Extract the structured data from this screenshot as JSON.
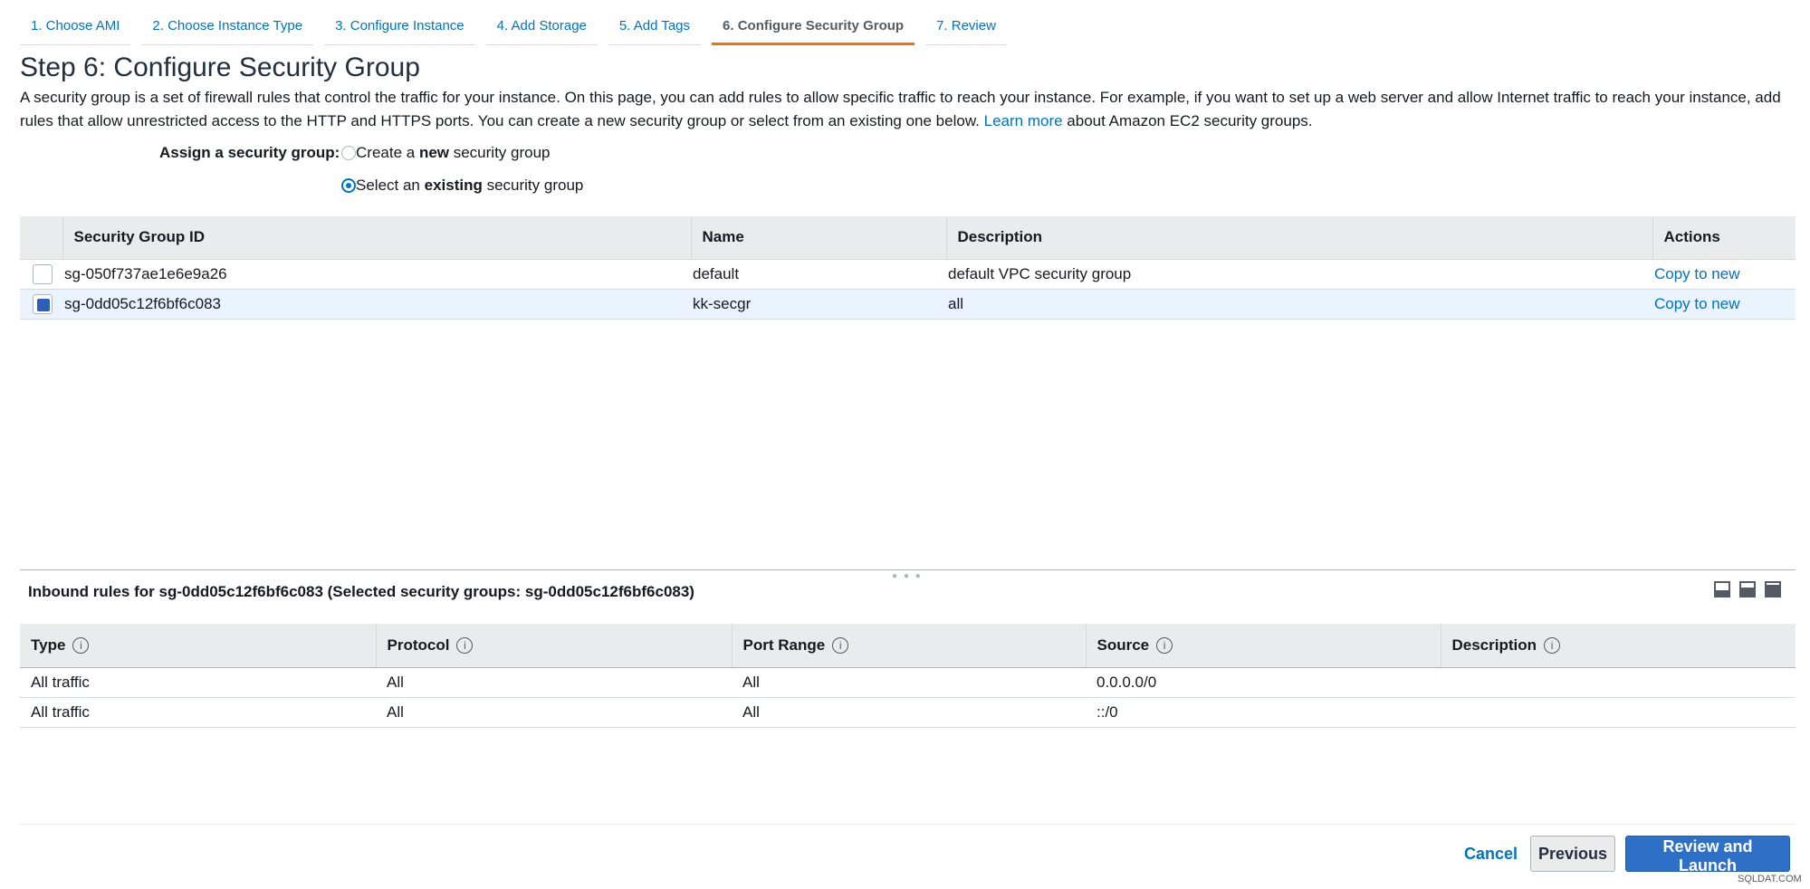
{
  "wizard_tabs": [
    "1. Choose AMI",
    "2. Choose Instance Type",
    "3. Configure Instance",
    "4. Add Storage",
    "5. Add Tags",
    "6. Configure Security Group",
    "7. Review"
  ],
  "page_title": "Step 6: Configure Security Group",
  "intro": {
    "text": "A security group is a set of firewall rules that control the traffic for your instance. On this page, you can add rules to allow specific traffic to reach your instance. For example, if you want to set up a web server and allow Internet traffic to reach your instance, add rules that allow unrestricted access to the HTTP and HTTPS ports. You can create a new security group or select from an existing one below.",
    "link": "Learn more",
    "suffix": "about Amazon EC2 security groups."
  },
  "assign": {
    "label": "Assign a security group:",
    "option_new_prefix": "Create a ",
    "option_new_bold": "new",
    "option_new_suffix": " security group",
    "option_existing_prefix": "Select an ",
    "option_existing_bold": "existing",
    "option_existing_suffix": " security group"
  },
  "sg_table": {
    "headers": [
      "Security Group ID",
      "Name",
      "Description",
      "Actions"
    ],
    "rows": [
      {
        "id": "sg-050f737ae1e6e9a26",
        "name": "default",
        "description": "default VPC security group",
        "action": "Copy to new"
      },
      {
        "id": "sg-0dd05c12f6bf6c083",
        "name": "kk-secgr",
        "description": "all",
        "action": "Copy to new"
      }
    ]
  },
  "inbound": {
    "title": "Inbound rules for sg-0dd05c12f6bf6c083 (Selected security groups: sg-0dd05c12f6bf6c083)",
    "headers": [
      "Type",
      "Protocol",
      "Port Range",
      "Source",
      "Description"
    ],
    "rows": [
      {
        "type": "All traffic",
        "protocol": "All",
        "port": "All",
        "source": "0.0.0.0/0",
        "description": ""
      },
      {
        "type": "All traffic",
        "protocol": "All",
        "port": "All",
        "source": "::/0",
        "description": ""
      }
    ]
  },
  "footer": {
    "cancel": "Cancel",
    "previous": "Previous",
    "review_launch": "Review and Launch"
  },
  "watermark": "SQLDAT.COM",
  "colors": {
    "link": "#0073bb",
    "active_tab_underline": "#ec7211",
    "primary_button": "#2e6fc7",
    "selected_row": "#eaf3fe"
  }
}
